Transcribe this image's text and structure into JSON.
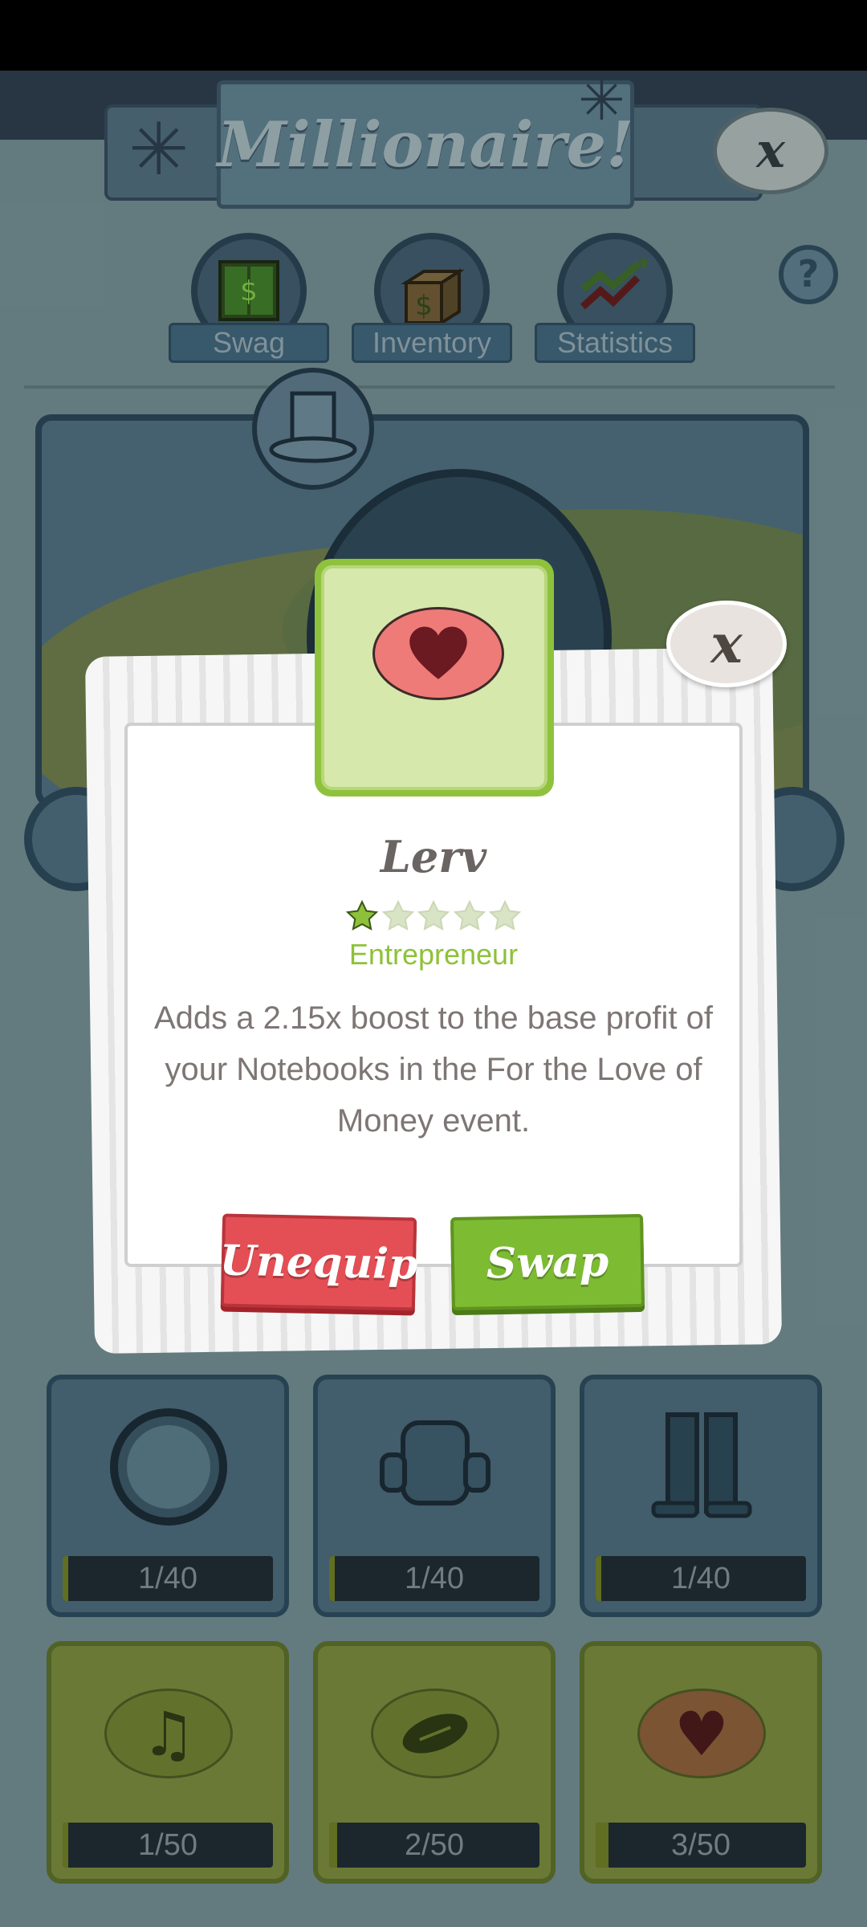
{
  "header": {
    "title": "Millionaire!"
  },
  "tabs": [
    {
      "label": "Swag",
      "icon": "money-door-icon"
    },
    {
      "label": "Inventory",
      "icon": "money-box-icon"
    },
    {
      "label": "Statistics",
      "icon": "trend-arrows-icon"
    }
  ],
  "help": {
    "label": "?"
  },
  "slots": [
    {
      "icon": "helmet-icon",
      "count": "1/40",
      "progress": 0.025,
      "style": "blue"
    },
    {
      "icon": "armor-icon",
      "count": "1/40",
      "progress": 0.025,
      "style": "blue"
    },
    {
      "icon": "boots-icon",
      "count": "1/40",
      "progress": 0.025,
      "style": "blue"
    },
    {
      "icon": "music-note-icon",
      "count": "1/50",
      "progress": 0.02,
      "style": "green"
    },
    {
      "icon": "football-icon",
      "count": "2/50",
      "progress": 0.04,
      "style": "green"
    },
    {
      "icon": "heart-icon",
      "count": "3/50",
      "progress": 0.06,
      "style": "green"
    }
  ],
  "popup": {
    "item_icon": "heart-icon",
    "item_name": "Lerv",
    "stars_total": 5,
    "stars_filled": 1,
    "rank": "Entrepreneur",
    "description": "Adds a 2.15x boost to the base profit of your Notebooks in the For the Love of Money event.",
    "unequip_label": "Unequip",
    "swap_label": "Swap",
    "close_label": "x"
  },
  "colors": {
    "accent_green": "#8ec13a",
    "unequip_red": "#e44f55",
    "swap_green": "#7dbb33",
    "heart_bg": "#ee7b78"
  }
}
